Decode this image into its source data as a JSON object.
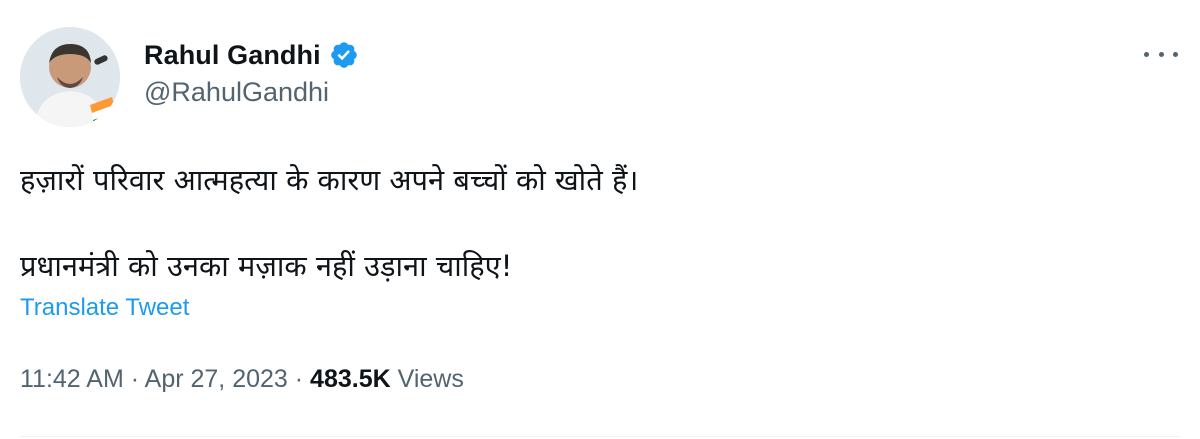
{
  "author": {
    "display_name": "Rahul Gandhi",
    "handle": "@RahulGandhi",
    "verified": true,
    "verified_color": "#1d9bf0",
    "avatar_icon": "profile-photo"
  },
  "tweet": {
    "lines": [
      "हज़ारों परिवार आत्महत्या के कारण अपने बच्चों को खोते हैं।",
      "प्रधानमंत्री को उनका मज़ाक नहीं उड़ाना चाहिए!"
    ],
    "translate_label": "Translate Tweet"
  },
  "meta": {
    "time": "11:42 AM",
    "separator": "·",
    "date": "Apr 27, 2023",
    "views_count": "483.5K",
    "views_label": "Views"
  },
  "colors": {
    "text_primary": "#0f1419",
    "text_secondary": "#536471",
    "link": "#1d9bf0"
  }
}
